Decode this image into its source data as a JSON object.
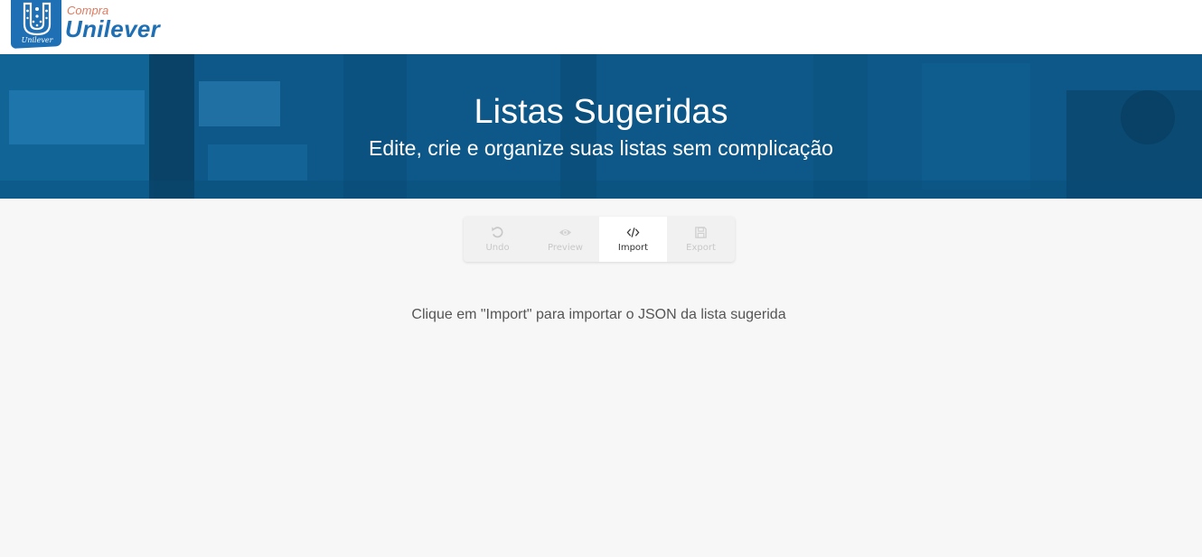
{
  "header": {
    "logo": {
      "small_text": "Unilever",
      "compra": "Compra",
      "brand": "Unilever"
    }
  },
  "banner": {
    "title": "Listas Sugeridas",
    "subtitle": "Edite, crie e organize suas listas sem complicação"
  },
  "toolbar": {
    "buttons": [
      {
        "label": "Undo",
        "icon": "undo-icon",
        "enabled": false
      },
      {
        "label": "Preview",
        "icon": "eye-icon",
        "enabled": false
      },
      {
        "label": "Import",
        "icon": "code-icon",
        "enabled": true,
        "active": true
      },
      {
        "label": "Export",
        "icon": "save-icon",
        "enabled": false
      }
    ]
  },
  "main": {
    "hint": "Clique em \"Import\" para importar o JSON da lista sugerida"
  },
  "colors": {
    "brand_blue": "#1f6fb5",
    "brand_orange": "#e07a5f",
    "banner_blue": "#0f5c8c",
    "page_bg": "#f7f7f7"
  }
}
